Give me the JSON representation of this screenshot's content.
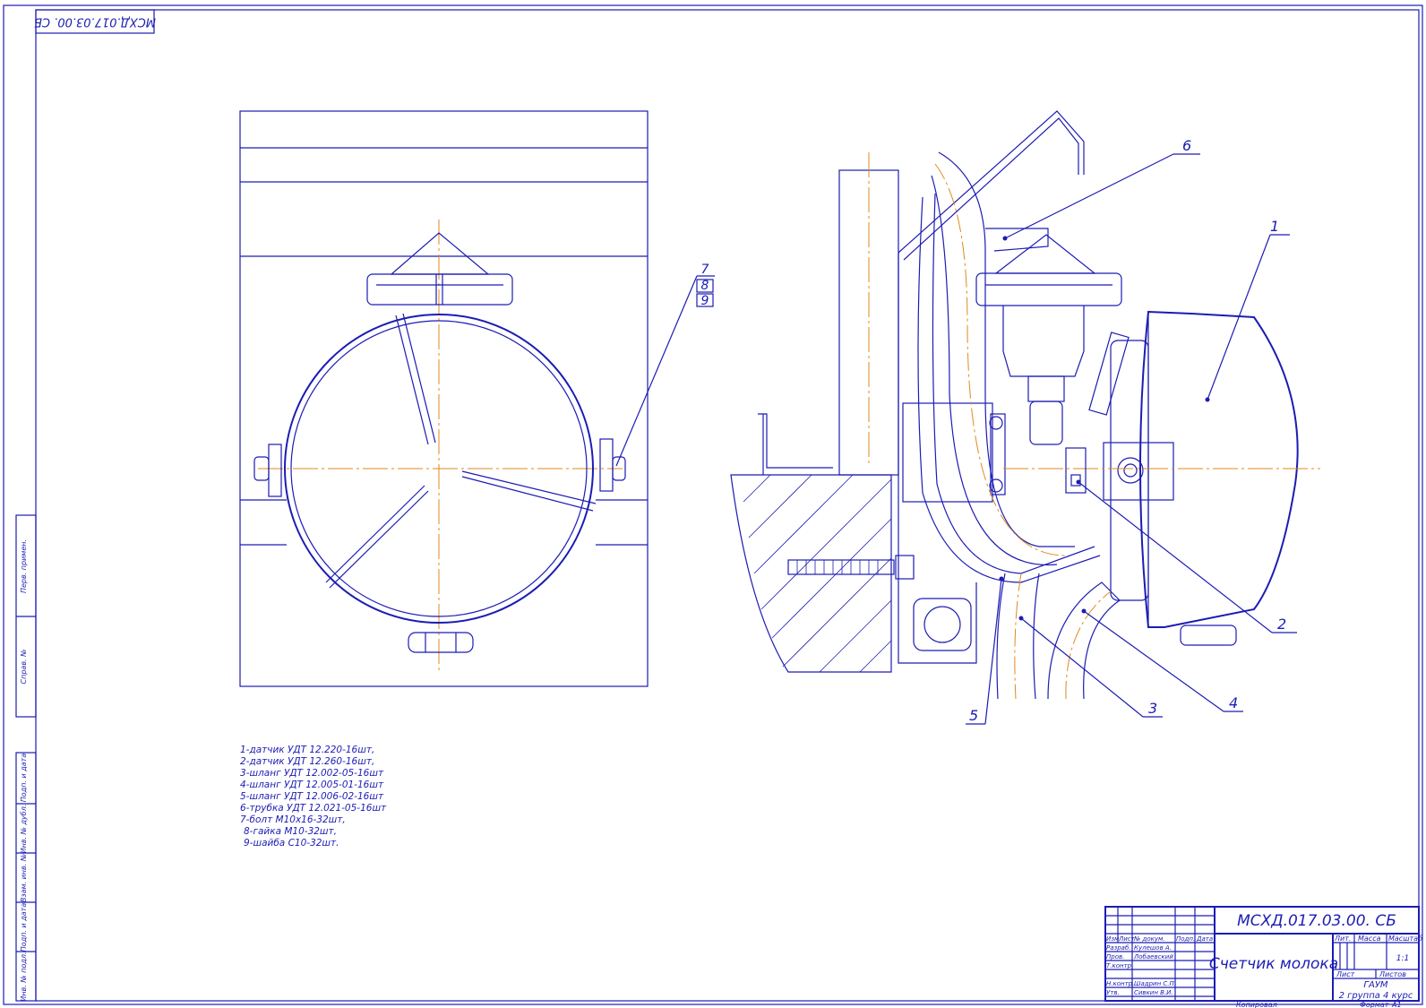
{
  "stamp_code_rotated": "МСХД.017.03.00. СБ",
  "left_strip": [
    "Перв. примен.",
    "Справ. №",
    "Подп. и дата",
    "Инв. № дубл.",
    "Взам. инв. №",
    "Подп. и дата",
    "Инв. № подл."
  ],
  "callouts": [
    "1",
    "2",
    "3",
    "4",
    "5",
    "6",
    "7",
    "8",
    "9"
  ],
  "parts_list": [
    "1-датчик УДТ 12.220-16шт,",
    "2-датчик УДТ 12.260-16шт,",
    "3-шланг УДТ 12.002-05-16шт",
    "4-шланг УДТ 12.005-01-16шт",
    "5-шланг УДТ 12.006-02-16шт",
    "6-трубка УДТ 12.021-05-16шт",
    "7-болт М10х16-32шт,",
    "8-гайка М10-32шт,",
    "9-шайба С10-32шт."
  ],
  "title_block": {
    "code": "МСХД.017.03.00. СБ",
    "name": "Счетчик молока",
    "headers": {
      "izm": "Изм",
      "list": "Лист",
      "doc": "№ докум.",
      "podp": "Подп.",
      "data": "Дата"
    },
    "roles": [
      {
        "role": "Разраб.",
        "person": "Кулешов А."
      },
      {
        "role": "Пров.",
        "person": "Лобаевский"
      },
      {
        "role": "Т.контр.",
        "person": ""
      },
      {
        "role": "Н.контр.",
        "person": "Шадрин С.П."
      },
      {
        "role": "Утв.",
        "person": "Сивкин В.И."
      }
    ],
    "lit": "Лит.",
    "mass": "Масса",
    "scale": "Масштаб",
    "scale_value": "1:1",
    "sheet": "Лист",
    "sheets": "Листов",
    "org": "ГАУМ",
    "group": "2 группа 4 курс",
    "copied": "Копировал",
    "format": "Формат",
    "format_value": "А1"
  }
}
